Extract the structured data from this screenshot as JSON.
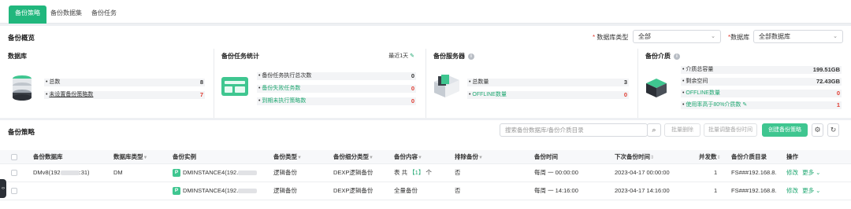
{
  "tabs": [
    {
      "label": "备份策略",
      "active": true
    },
    {
      "label": "备份数据集",
      "active": false
    },
    {
      "label": "备份任务",
      "active": false
    }
  ],
  "overview": {
    "title": "备份概览",
    "db_type_label": "数据库类型",
    "db_type_value": "全部",
    "db_label": "数据库",
    "db_value": "全部数据库"
  },
  "cards": {
    "database": {
      "title": "数据库",
      "rows": [
        {
          "label": "总数",
          "value": "8"
        },
        {
          "label": "未设置备份策略数",
          "value": "7"
        }
      ]
    },
    "tasks": {
      "title": "备份任务统计",
      "period": "最近1天",
      "rows": [
        {
          "label": "备份任务执行总次数",
          "value": "0"
        },
        {
          "label": "备份失败任务数",
          "value": "0"
        },
        {
          "label": "到期未执行策略数",
          "value": "0"
        }
      ]
    },
    "servers": {
      "title": "备份服务器",
      "rows": [
        {
          "label": "总数量",
          "value": "3"
        },
        {
          "label": "OFFLINE数量",
          "value": "0"
        }
      ]
    },
    "media": {
      "title": "备份介质",
      "rows": [
        {
          "label": "介质总容量",
          "value": "199.51GB"
        },
        {
          "label": "剩余空间",
          "value": "72.43GB"
        },
        {
          "label": "OFFLINE数量",
          "value": "0"
        },
        {
          "label": "使用率高于80%介质数",
          "value": "1"
        }
      ]
    }
  },
  "policy": {
    "title": "备份策略",
    "search_placeholder": "搜索备份数据库/备份介质目录",
    "btn_batch_delete": "批量删除",
    "btn_batch_adjust": "批量调整备份时间",
    "btn_create": "创建备份策略"
  },
  "table": {
    "headers": [
      "备份数据库",
      "数据库类型",
      "备份实例",
      "备份类型",
      "备份细分类型",
      "备份内容",
      "排除备份",
      "备份时间",
      "下次备份时间",
      "并发数",
      "备份介质目录",
      "操作"
    ],
    "rows": [
      {
        "database": "DMv8(192",
        "database_tail": ":31)",
        "db_type": "DM",
        "instance": "DMINSTANCE4(192.",
        "backup_type": "逻辑备份",
        "sub_type": "DEXP逻辑备份",
        "content_prefix": "表 共 ",
        "content_count": "【1】",
        "content_suffix": " 个",
        "exclude": "否",
        "time": "每周 一 00:00:00",
        "next_time": "2023-04-17 00:00:00",
        "concurrency": "1",
        "media_dir": "FS###192.168.8.",
        "op_edit": "修改",
        "op_more": "更多"
      },
      {
        "database": "",
        "database_tail": "",
        "db_type": "",
        "instance": "DMINSTANCE4(192.",
        "backup_type": "逻辑备份",
        "sub_type": "DEXP逻辑备份",
        "content_prefix": "全量备份",
        "content_count": "",
        "content_suffix": "",
        "exclude": "否",
        "time": "每周 一 14:16:00",
        "next_time": "2023-04-17 14:16:00",
        "concurrency": "1",
        "media_dir": "FS###192.168.8.",
        "op_edit": "修改",
        "op_more": "更多"
      }
    ]
  },
  "colors": {
    "accent": "#21b77d",
    "danger": "#e03c31"
  }
}
